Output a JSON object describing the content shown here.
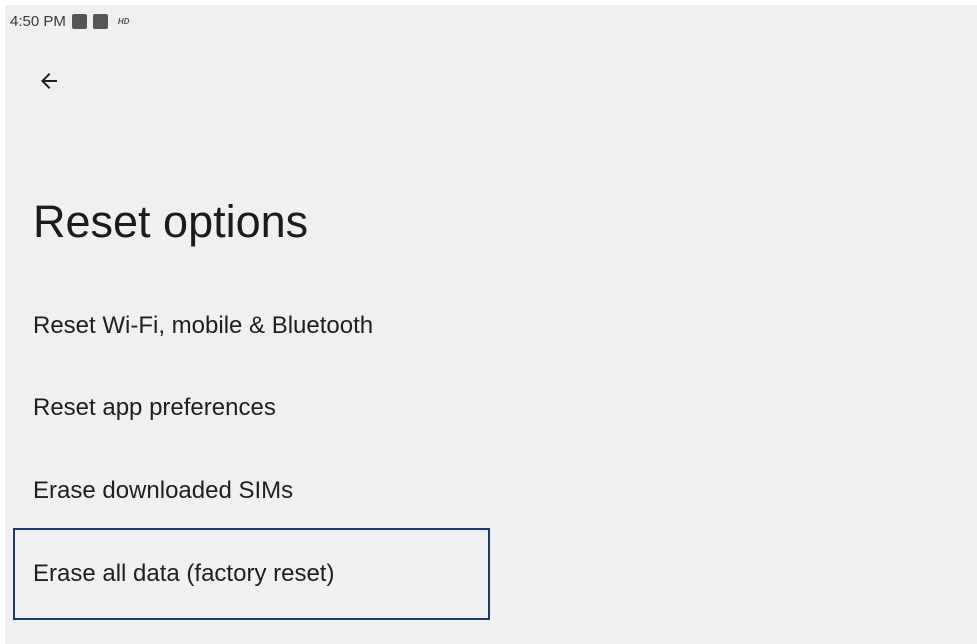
{
  "status_bar": {
    "time": "4:50 PM",
    "icons": [
      "notification-icon",
      "notification-icon"
    ],
    "hd_label": "HD"
  },
  "header": {
    "back_icon": "arrow-left-icon"
  },
  "page": {
    "title": "Reset options"
  },
  "options": [
    {
      "label": "Reset Wi-Fi, mobile & Bluetooth"
    },
    {
      "label": "Reset app preferences"
    },
    {
      "label": "Erase downloaded SIMs"
    },
    {
      "label": "Erase all data (factory reset)",
      "focused": true
    }
  ],
  "colors": {
    "background": "#f0f0f3",
    "focus_border": "#1a3a6b",
    "text": "#1f1f1f"
  }
}
